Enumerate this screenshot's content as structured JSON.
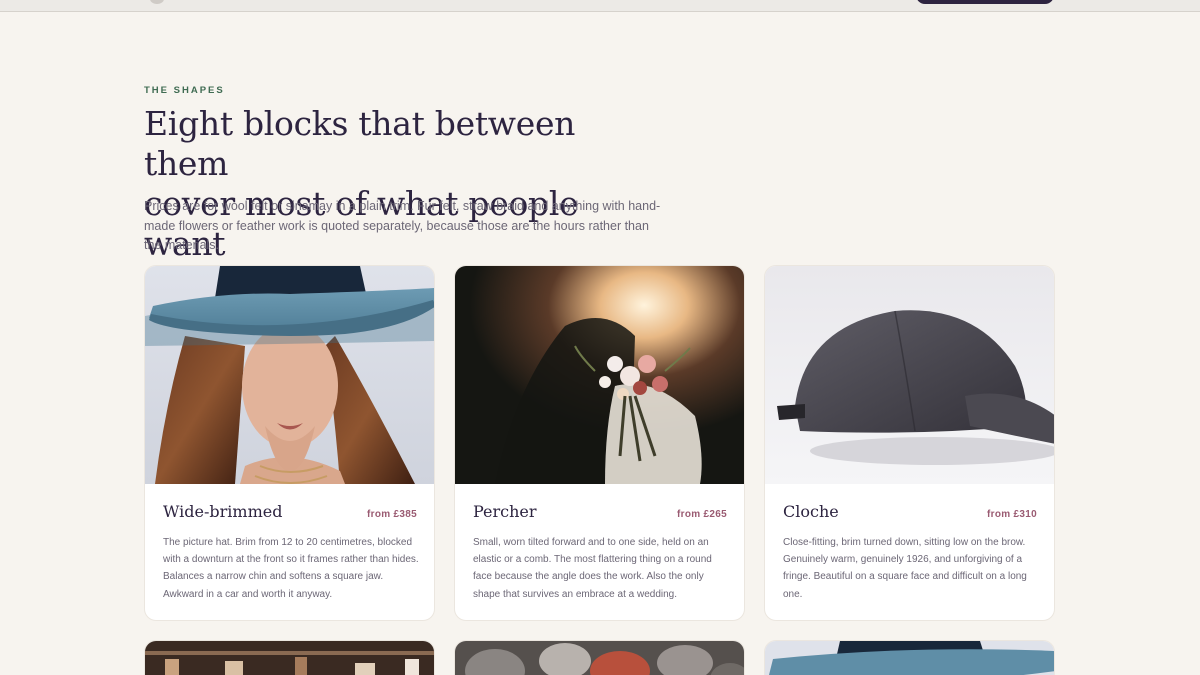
{
  "section": {
    "eyebrow": "THE SHAPES",
    "title_line1": "Eight blocks that between them",
    "title_line2": "cover most of what people want",
    "intro": "Prices are for wool felt or sinamay in a plain trim. Fur felt, straw braid and anything with hand-made flowers or feather work is quoted separately, because those are the hours rather than the materials."
  },
  "cards": [
    {
      "name": "Wide-brimmed",
      "price": "from £385",
      "description": "The picture hat. Brim from 12 to 20 centimetres, blocked with a downturn at the front so it frames rather than hides. Balances a narrow chin and softens a square jaw. Awkward in a car and worth it anyway.",
      "image_icon": "woman-in-blue-wide-brim-hat-photo"
    },
    {
      "name": "Percher",
      "price": "from £265",
      "description": "Small, worn tilted forward and to one side, held on an elastic or a comb. The most flattering thing on a round face because the angle does the work. Also the only shape that survives an embrace at a wedding.",
      "image_icon": "bridal-bouquet-photo"
    },
    {
      "name": "Cloche",
      "price": "from £310",
      "description": "Close-fitting, brim turned down, sitting low on the brow. Genuinely warm, genuinely 1926, and unforgiving of a fringe. Beautiful on a square face and difficult on a long one.",
      "image_icon": "grey-cap-photo"
    }
  ],
  "colors": {
    "background": "#f7f4ef",
    "heading": "#2d2440",
    "eyebrow": "#3f6b52",
    "price": "#9a5b72",
    "body_text": "#6c6776"
  }
}
